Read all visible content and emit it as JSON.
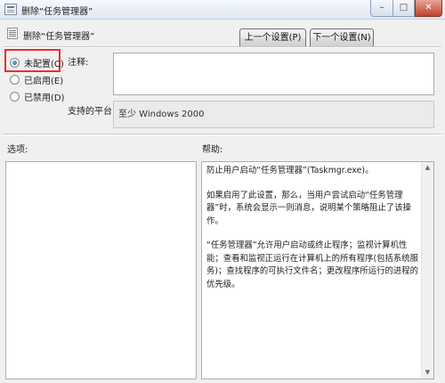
{
  "window": {
    "title": "删除“任务管理器”",
    "minimize_glyph": "–",
    "maximize_glyph": "□",
    "close_glyph": "✕"
  },
  "header": {
    "policy_name": "删除“任务管理器”",
    "prev_button": "上一个设置(P)",
    "next_button": "下一个设置(N)"
  },
  "state_options": [
    {
      "label": "未配置(C)",
      "checked": true
    },
    {
      "label": "已启用(E)",
      "checked": false
    },
    {
      "label": "已禁用(D)",
      "checked": false
    }
  ],
  "comment": {
    "label": "注释:",
    "value": ""
  },
  "platform": {
    "label": "支持的平台:",
    "value": "至少 Windows 2000"
  },
  "options": {
    "label": "选项:"
  },
  "help": {
    "label": "帮助:",
    "paragraphs": [
      "防止用户启动“任务管理器”(Taskmgr.exe)。",
      "如果启用了此设置，那么，当用户尝试启动“任务管理器”时，系统会显示一则消息，说明某个策略阻止了该操作。",
      "“任务管理器”允许用户启动或终止程序；监视计算机性能；查看和监视正运行在计算机上的所有程序(包括系统服务)；查找程序的可执行文件名；更改程序所运行的进程的优先级。"
    ]
  },
  "scrollbar": {
    "up_glyph": "▲",
    "down_glyph": "▼"
  },
  "colors": {
    "highlight": "#e8302f",
    "radio_selected": "#1d5fa3"
  },
  "icons": [
    "app-icon",
    "policy-icon",
    "minimize-icon",
    "maximize-icon",
    "close-icon",
    "scroll-up-icon",
    "scroll-down-icon"
  ]
}
